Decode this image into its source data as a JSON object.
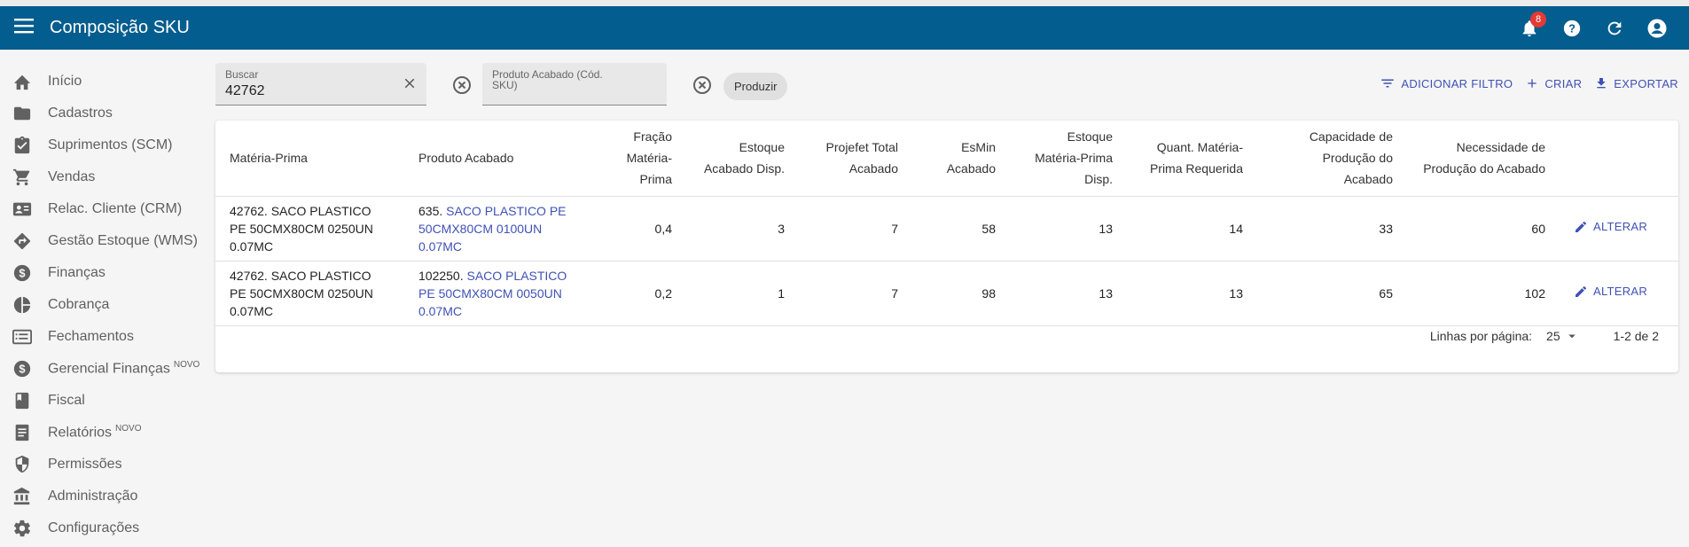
{
  "appbar": {
    "title": "Composição SKU",
    "notification_count": "8",
    "icons": [
      "menu-icon",
      "bell-icon",
      "help-icon",
      "refresh-icon",
      "account-icon"
    ]
  },
  "sidebar": {
    "items": [
      {
        "label": "Início",
        "icon": "home-icon",
        "tag": ""
      },
      {
        "label": "Cadastros",
        "icon": "folder-icon",
        "tag": ""
      },
      {
        "label": "Suprimentos (SCM)",
        "icon": "clipboard-icon",
        "tag": ""
      },
      {
        "label": "Vendas",
        "icon": "cart-icon",
        "tag": ""
      },
      {
        "label": "Relac. Cliente (CRM)",
        "icon": "contact-card-icon",
        "tag": ""
      },
      {
        "label": "Gestão Estoque (WMS)",
        "icon": "directions-icon",
        "tag": ""
      },
      {
        "label": "Finanças",
        "icon": "dollar-circle-icon",
        "tag": ""
      },
      {
        "label": "Cobrança",
        "icon": "pie-chart-icon",
        "tag": ""
      },
      {
        "label": "Fechamentos",
        "icon": "list-icon",
        "tag": ""
      },
      {
        "label": "Gerencial Finanças",
        "icon": "dollar-circle-icon",
        "tag": "NOVO"
      },
      {
        "label": "Fiscal",
        "icon": "book-icon",
        "tag": ""
      },
      {
        "label": "Relatórios",
        "icon": "document-icon",
        "tag": "NOVO"
      },
      {
        "label": "Permissões",
        "icon": "shield-icon",
        "tag": ""
      },
      {
        "label": "Administração",
        "icon": "bank-icon",
        "tag": ""
      },
      {
        "label": "Configurações",
        "icon": "gear-icon",
        "tag": ""
      }
    ]
  },
  "filters": {
    "search_label": "Buscar",
    "search_value": "42762",
    "product_label": "Produto Acabado (Cód. SKU)",
    "produce_chip": "Produzir",
    "add_filter": "ADICIONAR FILTRO",
    "create": "CRIAR",
    "export": "EXPORTAR"
  },
  "table": {
    "headers": [
      "Matéria-Prima",
      "Produto Acabado",
      "Fração Matéria-Prima",
      "Estoque Acabado Disp.",
      "Projefet Total Acabado",
      "EsMin Acabado",
      "Estoque Matéria-Prima Disp.",
      "Quant. Matéria-Prima Requerida",
      "Capacidade de Produção do Acabado",
      "Necessidade de Produção do Acabado"
    ],
    "edit_label": "ALTERAR",
    "rows": [
      {
        "materia": "42762. SACO PLASTICO PE 50CMX80CM 0250UN 0.07MC",
        "produto_code": "635. ",
        "produto_name": "SACO PLASTICO PE 50CMX80CM 0100UN 0.07MC",
        "fracao": "0,4",
        "estoque_acabado": "3",
        "projefet": "7",
        "esmin": "58",
        "estoque_mp": "13",
        "quant_mp": "14",
        "capacidade": "33",
        "necessidade": "60"
      },
      {
        "materia": "42762. SACO PLASTICO PE 50CMX80CM 0250UN 0.07MC",
        "produto_code": "102250. ",
        "produto_name": "SACO PLASTICO PE 50CMX80CM 0050UN 0.07MC",
        "fracao": "0,2",
        "estoque_acabado": "1",
        "projefet": "7",
        "esmin": "98",
        "estoque_mp": "13",
        "quant_mp": "13",
        "capacidade": "65",
        "necessidade": "102"
      }
    ]
  },
  "pagination": {
    "rows_per_page_label": "Linhas por página:",
    "rows_per_page": "25",
    "range": "1-2 de 2"
  },
  "colors": {
    "appbar": "#035d8e",
    "accent": "#3f51b5",
    "badge": "#e53935"
  }
}
